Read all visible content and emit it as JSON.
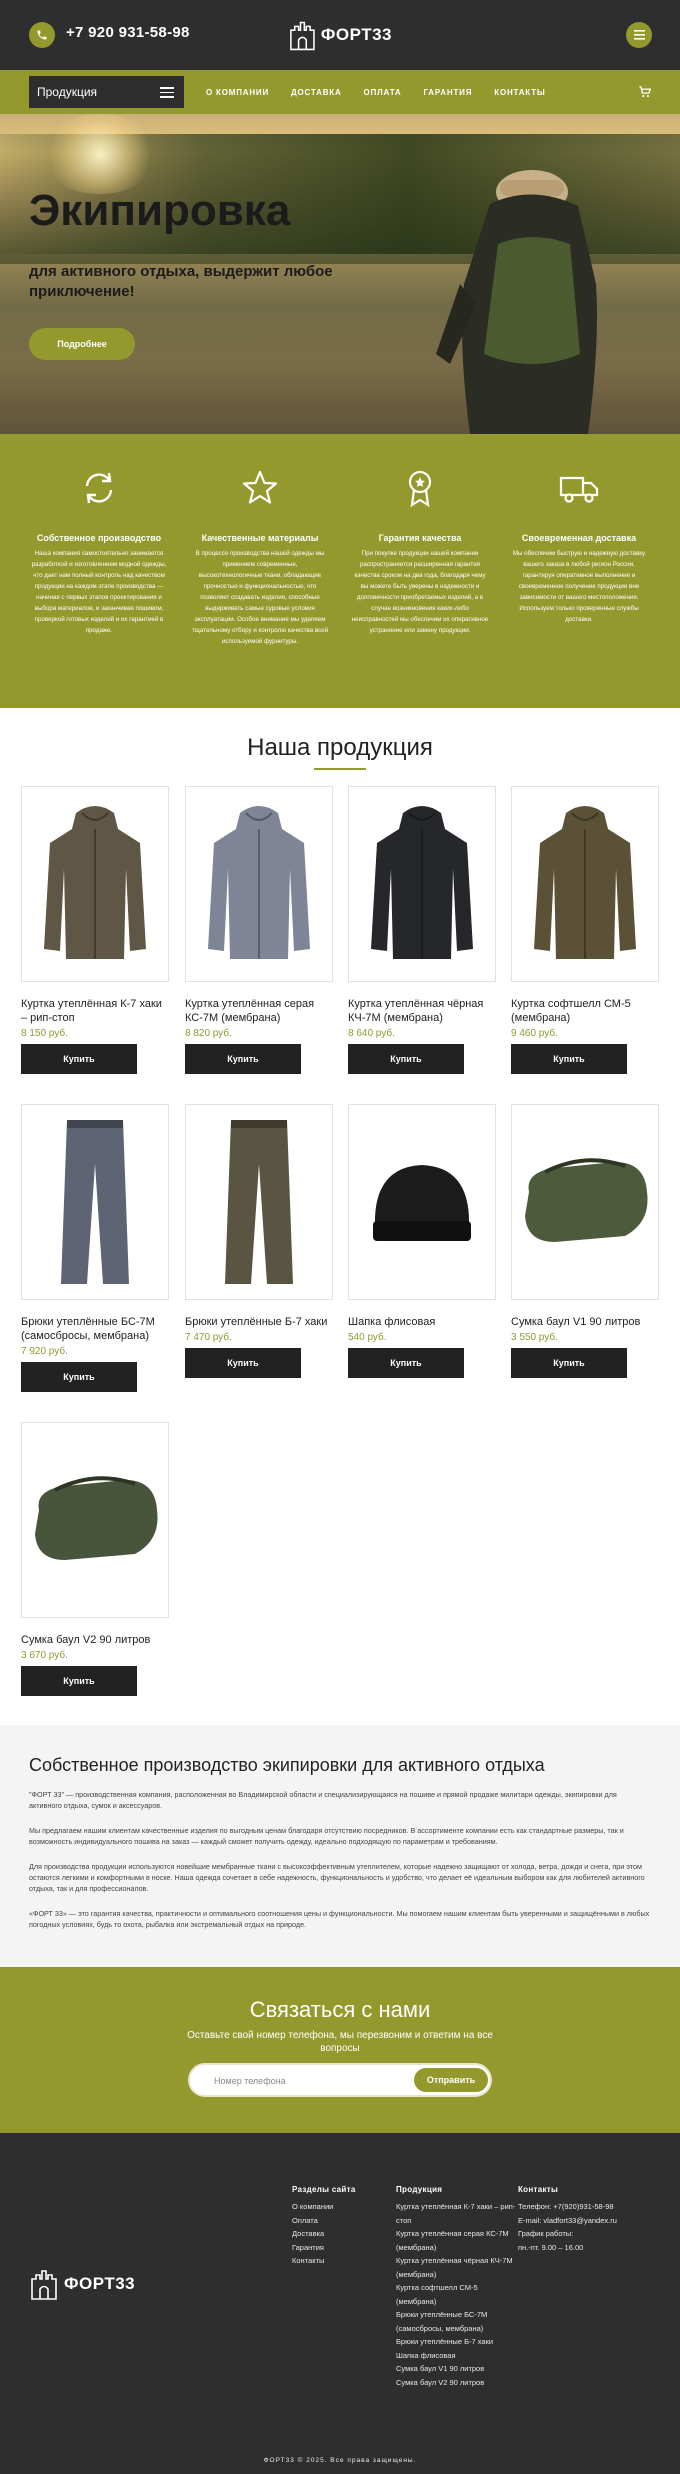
{
  "header": {
    "phone": "+7 920 931-58-98",
    "logo_text": "ФОРТ33"
  },
  "nav": {
    "products_label": "Продукция",
    "links": [
      "О КОМПАНИИ",
      "ДОСТАВКА",
      "ОПЛАТА",
      "ГАРАНТИЯ",
      "КОНТАКТЫ"
    ]
  },
  "hero": {
    "title": "Экипировка",
    "subtitle": "для активного отдыха, выдержит любое приключение!",
    "button": "Подробнее"
  },
  "features": [
    {
      "icon": "refresh-icon",
      "title": "Собственное производство",
      "text": "Наша компания самостоятельно занимается разработкой и изготовлением модной одежды, что дает нам полный контроль над качеством продукции на каждом этапе производства — начиная с первых этапов проектирования и выбора материалов, и заканчивая пошивом, проверкой готовых изделий и их гарантией в продаже."
    },
    {
      "icon": "star-icon",
      "title": "Качественные материалы",
      "text": "В процессе производства нашей одежды мы применяем современные, высокотехнологичные ткани, обладающие прочностью и функциональностью, что позволяет создавать изделия, способные выдерживать самые суровые условия эксплуатации. Особое внимание мы уделяем тщательному отбору и контролю качества всей используемой фурнитуры."
    },
    {
      "icon": "award-icon",
      "title": "Гарантия качества",
      "text": "При покупке продукции нашей компании распространяется расширенная гарантия качества сроком на два года, благодаря чему вы можете быть уверены в надежности и долговечности приобретаемых изделий, а в случае возникновения каких-либо неисправностей мы обеспечим их оперативное устранение или замену продукции."
    },
    {
      "icon": "truck-icon",
      "title": "Своевременная доставка",
      "text": "Мы обеспечим быструю и надежную доставку вашего заказа в любой регион России, гарантируя оперативное выполнение и своевременное получение продукции вне зависимости от вашего местоположения. Используем только проверенные службы доставки."
    }
  ],
  "products": {
    "title": "Наша продукция",
    "buy_label": "Купить",
    "items": [
      {
        "name": "Куртка утеплённая К-7 хаки – рип-стоп",
        "price": "8 150 руб.",
        "kind": "jacket",
        "color": "#5f5646"
      },
      {
        "name": "Куртка утеплённая серая КС-7М (мембрана)",
        "price": "8 820 руб.",
        "kind": "jacket",
        "color": "#7f8596"
      },
      {
        "name": "Куртка утеплённая чёрная КЧ-7М (мембрана)",
        "price": "8 640 руб.",
        "kind": "jacket",
        "color": "#26272a"
      },
      {
        "name": "Куртка софтшелл СМ-5 (мембрана)",
        "price": "9 460 руб.",
        "kind": "jacket",
        "color": "#5b5136"
      },
      {
        "name": "Брюки утеплённые БС-7М (самосбросы, мембрана)",
        "price": "7 920 руб.",
        "kind": "pants",
        "color": "#5e6473"
      },
      {
        "name": "Брюки утеплённые Б-7 хаки",
        "price": "7 470 руб.",
        "kind": "pants",
        "color": "#5a5443"
      },
      {
        "name": "Шапка флисовая",
        "price": "540 руб.",
        "kind": "hat",
        "color": "#1c1c1c"
      },
      {
        "name": "Сумка баул V1 90 литров",
        "price": "3 550 руб.",
        "kind": "bag",
        "color": "#4d5a3c"
      },
      {
        "name": "Сумка баул V2 90 литров",
        "price": "3 670 руб.",
        "kind": "bag",
        "color": "#48553a"
      }
    ]
  },
  "about": {
    "title": "Собственное производство экипировки для активного отдыха",
    "p1": "\"ФОРТ 33\" — производственная компания, расположенная во Владимирской области и специализирующаяся на пошиве и прямой продаже милитари одежды, экипировки для активного отдыха, сумок и аксессуаров.",
    "p2": "Мы предлагаем нашим клиентам качественные изделия по выгодным ценам благодаря отсутствию посредников. В ассортименте компании есть как стандартные размеры, так и возможность индивидуального пошива на заказ — каждый сможет получить одежду, идеально подходящую по параметрам и требованиям.",
    "p3": "Для производства продукции используются новейшие мембранные ткани с высокоэффективным утеплителем, которые надежно защищают от холода, ветра, дождя и снега, при этом остаются легкими и комфортными в носке. Наша одежда сочетает в себе надежность, функциональность и удобство, что делает её идеальным выбором как для любителей активного отдыха, так и для профессионалов.",
    "p4": "«ФОРТ 33» — это гарантия качества, практичности и оптимального соотношения цены и функциональности. Мы помогаем нашим клиентам быть уверенными и защищёнными в любых погодных условиях, будь то охота, рыбалка или экстремальный отдых на природе."
  },
  "contact": {
    "title": "Связаться с нами",
    "subtitle": "Оставьте свой номер телефона, мы перезвоним и ответим на все вопросы",
    "placeholder": "Номер телефона",
    "button": "Отправить"
  },
  "footer": {
    "logo_text": "ФОРТ33",
    "sections_title": "Разделы сайта",
    "sections": [
      "О компании",
      "Оплата",
      "Доставка",
      "Гарантия",
      "Контакты"
    ],
    "products_title": "Продукция",
    "products": [
      "Куртка утеплённая К-7 хаки – рип-стоп",
      "Куртка утеплённая серая КС-7М (мембрана)",
      "Куртка утеплённая чёрная КЧ-7М (мембрана)",
      "Куртка софтшелл СМ-5 (мембрана)",
      "Брюки утеплённые БС-7М (самосбросы, мембрана)",
      "Брюки утеплённые Б-7 хаки",
      "Шапка флисовая",
      "Сумка баул V1 90 литров",
      "Сумка баул V2 90 литров"
    ],
    "contacts_title": "Контакты",
    "contacts": [
      "Телефон: +7(920)931-58-98",
      "E-mail: vladfort33@yandex.ru",
      "График работы:",
      "пн.-пт. 9.00 – 16.00"
    ],
    "copyright": "ФОРТ33 © 2025. Все права защищены."
  },
  "colors": {
    "accent": "#94992e",
    "dark": "#2e2e2e"
  }
}
